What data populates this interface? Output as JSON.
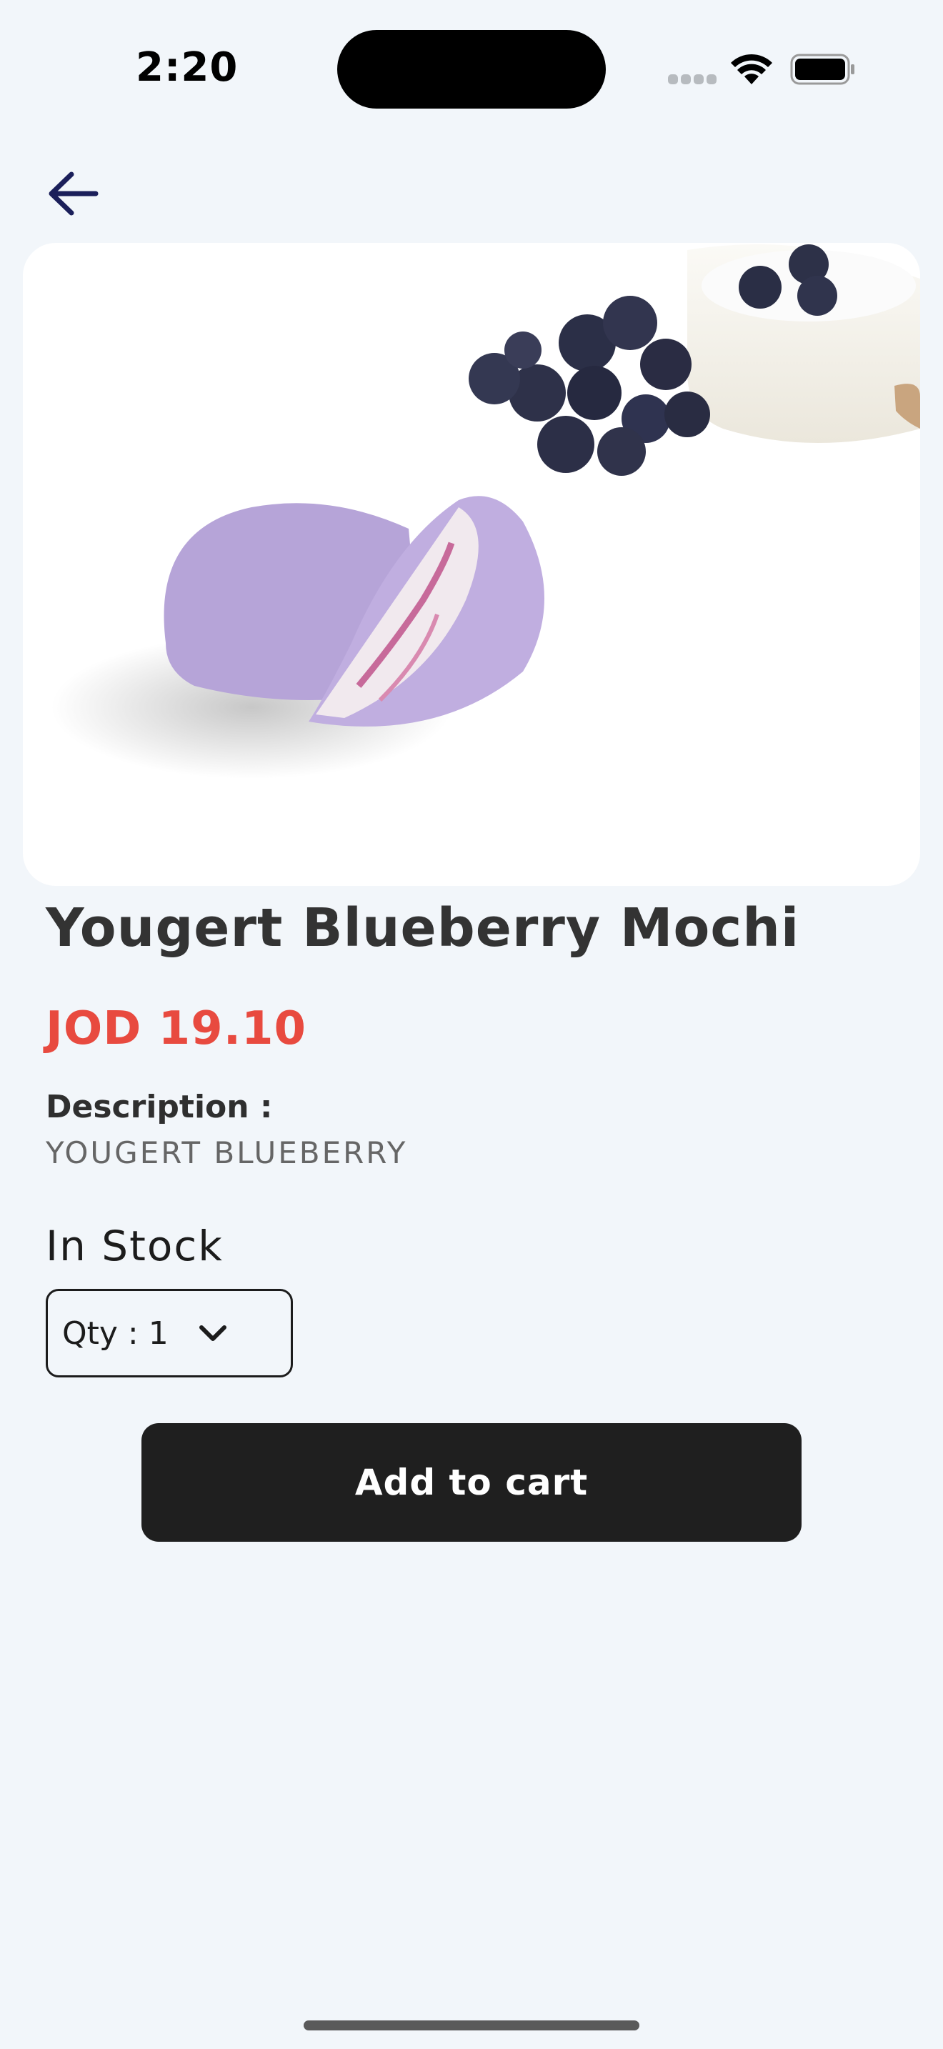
{
  "status_bar": {
    "time": "2:20"
  },
  "product": {
    "title": "Yougert Blueberry Mochi",
    "price": "JOD 19.10",
    "description_label": "Description :",
    "description": "YOUGERT BLUEBERRY",
    "stock_status": "In Stock",
    "quantity_label": "Qty : 1",
    "image_icon": "mochi-product-photo"
  },
  "actions": {
    "add_to_cart": "Add to cart"
  },
  "colors": {
    "background": "#f2f6fa",
    "price": "#e84a3f",
    "button": "#1f1f1f",
    "back_icon": "#1b1f5a"
  }
}
